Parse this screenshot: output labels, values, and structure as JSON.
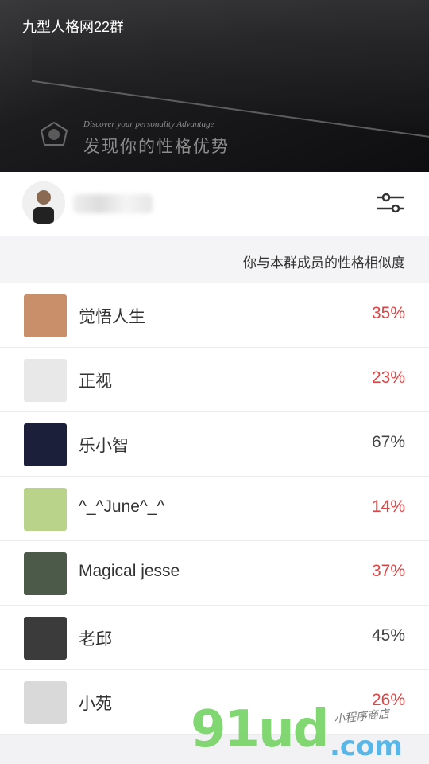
{
  "header": {
    "group_title": "九型人格网22群",
    "tagline_en": "Discover your personality Advantage",
    "tagline_cn": "发现你的性格优势"
  },
  "subhead": "你与本群成员的性格相似度",
  "members": [
    {
      "name": "觉悟人生",
      "percent": "35%",
      "color": "#e04545",
      "avatar": "#c98f6a"
    },
    {
      "name": "正视",
      "percent": "23%",
      "color": "#e04545",
      "avatar": "#e8e8e8"
    },
    {
      "name": "乐小智",
      "percent": "67%",
      "color": "#444444",
      "avatar": "#1b1f3a"
    },
    {
      "name": "^_^June^_^",
      "percent": "14%",
      "color": "#e04545",
      "avatar": "#b9d48a"
    },
    {
      "name": "Magical jesse",
      "percent": "37%",
      "color": "#e04545",
      "avatar": "#4c5a4a"
    },
    {
      "name": "老邱",
      "percent": "45%",
      "color": "#444444",
      "avatar": "#3b3b3b"
    },
    {
      "name": "小苑",
      "percent": "26%",
      "color": "#e04545",
      "avatar": "#d9d9d9"
    }
  ],
  "watermark": {
    "main": "91ud",
    "domain": ".com",
    "script": "小程序商店"
  },
  "icons": {
    "filter": "filter-sliders-icon",
    "logo": "enneagram-logo-icon"
  }
}
